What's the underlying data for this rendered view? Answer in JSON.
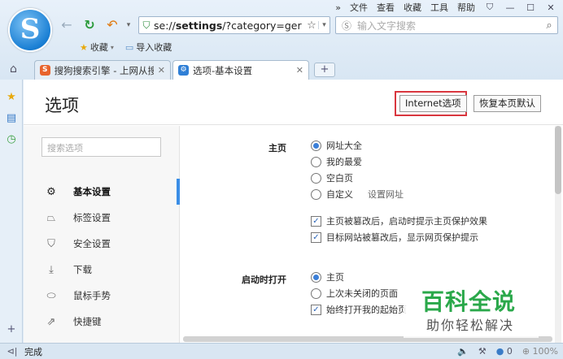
{
  "menubar": {
    "expand": "»",
    "items": [
      "文件",
      "查看",
      "收藏",
      "工具",
      "帮助"
    ],
    "window_controls": [
      "skin-icon",
      "minimize-icon",
      "maximize-icon",
      "close-icon"
    ]
  },
  "toolbar": {
    "logo_letter": "S",
    "address": {
      "prefix": "se://",
      "bold": "settings",
      "suffix": "/?category=ger"
    },
    "search_placeholder": "输入文字搜索"
  },
  "bookmarks": {
    "favorites": "收藏",
    "import": "导入收藏"
  },
  "tabs": [
    {
      "title": "搜狗搜索引擎 - 上网从搜",
      "favicon": "S",
      "color": "#e8632c",
      "active": false
    },
    {
      "title": "选项-基本设置",
      "favicon": "⚙",
      "color": "#2f7fd6",
      "active": true
    }
  ],
  "new_tab": "+",
  "page": {
    "title": "选项",
    "ie_button": "Internet选项",
    "reset_button": "恢复本页默认",
    "search_placeholder": "搜索选项"
  },
  "sidebar": [
    {
      "icon": "gear-icon",
      "glyph": "⚙",
      "label": "基本设置",
      "active": true
    },
    {
      "icon": "tab-icon",
      "glyph": "⏢",
      "label": "标签设置",
      "active": false
    },
    {
      "icon": "security-icon",
      "glyph": "⛉",
      "label": "安全设置",
      "active": false
    },
    {
      "icon": "download-icon",
      "glyph": "⤓",
      "label": "下载",
      "active": false
    },
    {
      "icon": "mouse-icon",
      "glyph": "⬭",
      "label": "鼠标手势",
      "active": false
    },
    {
      "icon": "shortcut-icon",
      "glyph": "⇗",
      "label": "快捷键",
      "active": false
    }
  ],
  "homepage": {
    "label": "主页",
    "options": [
      {
        "label": "网址大全",
        "selected": true
      },
      {
        "label": "我的最爱",
        "selected": false
      },
      {
        "label": "空白页",
        "selected": false
      },
      {
        "label": "自定义",
        "selected": false
      }
    ],
    "custom_link": "设置网址",
    "checks": [
      {
        "label": "主页被篡改后，启动时提示主页保护效果",
        "checked": true
      },
      {
        "label": "目标网站被篡改后，显示网页保护提示",
        "checked": true
      }
    ]
  },
  "startup": {
    "label": "启动时打开",
    "options": [
      {
        "label": "主页",
        "selected": true
      },
      {
        "label": "上次未关闭的页面",
        "selected": false
      }
    ],
    "check": {
      "label": "始终打开我的起始页",
      "checked": true
    }
  },
  "watermark": {
    "main": "百科全说",
    "sub": "助你轻松解决"
  },
  "status": {
    "text": "完成",
    "zoom": "100%",
    "count": "0"
  }
}
